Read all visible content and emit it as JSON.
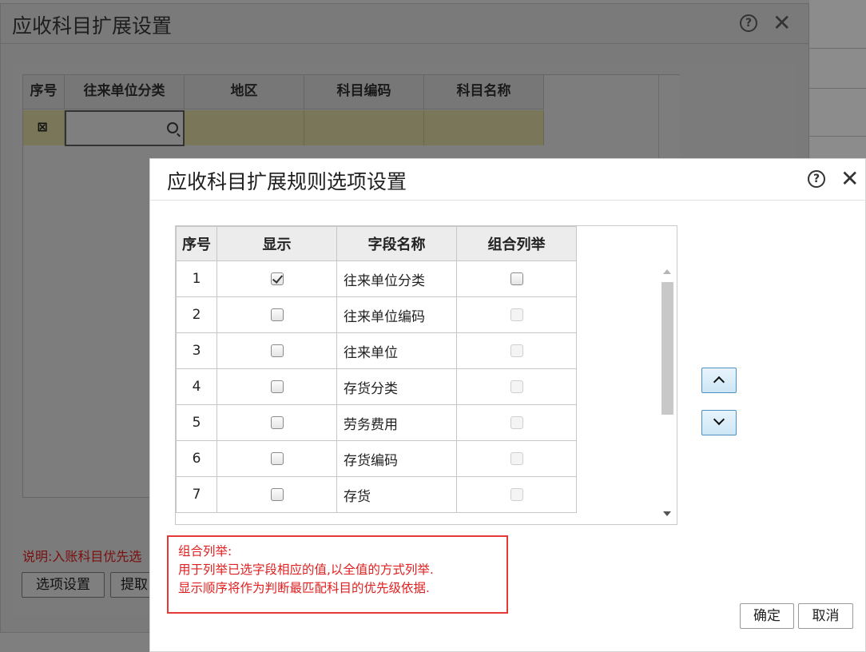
{
  "back_dialog": {
    "title": "应收科目扩展设置",
    "grid": {
      "columns": [
        "序号",
        "往来单位分类",
        "地区",
        "科目编码",
        "科目名称"
      ]
    },
    "note": "说明:入账科目优先选",
    "buttons": {
      "options": "选项设置",
      "extract": "提取"
    }
  },
  "front_dialog": {
    "title": "应收科目扩展规则选项设置",
    "grid": {
      "columns": [
        "序号",
        "显示",
        "字段名称",
        "组合列举"
      ],
      "rows": [
        {
          "index": "1",
          "show": true,
          "field": "往来单位分类",
          "combine": false,
          "combine_enabled": true
        },
        {
          "index": "2",
          "show": false,
          "field": "往来单位编码",
          "combine": false,
          "combine_enabled": false
        },
        {
          "index": "3",
          "show": false,
          "field": "往来单位",
          "combine": false,
          "combine_enabled": false
        },
        {
          "index": "4",
          "show": false,
          "field": "存货分类",
          "combine": false,
          "combine_enabled": false
        },
        {
          "index": "5",
          "show": false,
          "field": "劳务费用",
          "combine": false,
          "combine_enabled": false
        },
        {
          "index": "6",
          "show": false,
          "field": "存货编码",
          "combine": false,
          "combine_enabled": false
        },
        {
          "index": "7",
          "show": false,
          "field": "存货",
          "combine": false,
          "combine_enabled": false
        }
      ]
    },
    "note": {
      "title": "组合列举:",
      "line1": "用于列举已选字段相应的值,以全值的方式列举.",
      "line2": "显示顺序将作为判断最匹配科目的优先级依据."
    },
    "buttons": {
      "ok": "确定",
      "cancel": "取消"
    }
  },
  "colors": {
    "note_text": "#e02020",
    "note_border": "#e53935",
    "move_button_border": "#4d8fc0"
  }
}
